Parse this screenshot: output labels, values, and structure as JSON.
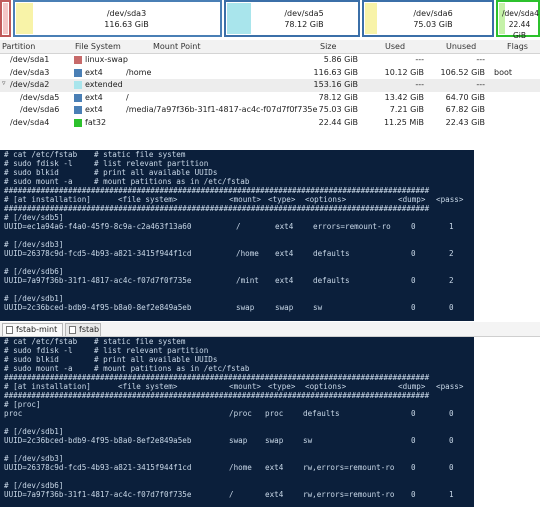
{
  "partition_bar": [
    {
      "name": "",
      "size": ""
    },
    {
      "name": "/dev/sda3",
      "size": "116.63 GiB"
    },
    {
      "name": "/dev/sda5",
      "size": "78.12 GiB"
    },
    {
      "name": "/dev/sda6",
      "size": "75.03 GiB"
    },
    {
      "name": "/dev/sda4",
      "size": "22.44 GiB"
    }
  ],
  "table": {
    "headers": {
      "partition": "Partition",
      "filesystem": "File System",
      "mount": "Mount Point",
      "size": "Size",
      "used": "Used",
      "unused": "Unused",
      "flags": "Flags"
    },
    "rows": [
      {
        "partition": "/dev/sda1",
        "fs": "linux-swap",
        "fs_color": "#c76a6a",
        "mount": "",
        "size": "5.86 GiB",
        "used": "---",
        "unused": "---",
        "flags": ""
      },
      {
        "partition": "/dev/sda3",
        "fs": "ext4",
        "fs_color": "#4a7fb5",
        "mount": "/home",
        "size": "116.63 GiB",
        "used": "10.12 GiB",
        "unused": "106.52 GiB",
        "flags": "boot"
      },
      {
        "partition": "/dev/sda2",
        "fs": "extended",
        "fs_color": "#a9e5ec",
        "mount": "",
        "size": "153.16 GiB",
        "used": "---",
        "unused": "---",
        "flags": ""
      },
      {
        "partition": "/dev/sda5",
        "fs": "ext4",
        "fs_color": "#4a7fb5",
        "mount": "/",
        "size": "78.12 GiB",
        "used": "13.42 GiB",
        "unused": "64.70 GiB",
        "flags": ""
      },
      {
        "partition": "/dev/sda6",
        "fs": "ext4",
        "fs_color": "#4a7fb5",
        "mount": "/media/7a97f36b-31f1-4817-ac4c-f07d7f0f735e",
        "size": "75.03 GiB",
        "used": "7.21 GiB",
        "unused": "67.82 GiB",
        "flags": ""
      },
      {
        "partition": "/dev/sda4",
        "fs": "fat32",
        "fs_color": "#2cc12c",
        "mount": "",
        "size": "22.44 GiB",
        "used": "11.25 MiB",
        "unused": "22.43 GiB",
        "flags": ""
      }
    ]
  },
  "terminal1": {
    "commands": [
      {
        "cmd": "# cat /etc/fstab",
        "comment": "# static file system"
      },
      {
        "cmd": "# sudo fdisk -l",
        "comment": "# list relevant partition"
      },
      {
        "cmd": "# sudo blkid",
        "comment": "# print all available UUIDs"
      },
      {
        "cmd": "# sudo mount -a",
        "comment": "# mount patitions as in /etc/fstab"
      }
    ],
    "hashline": "#############################################################################################",
    "header": {
      "c1": "# [at installation]",
      "c2": "<file system>",
      "c3": "<mount>",
      "c4": "<type>",
      "c5": "<options>",
      "c6": "<dump>",
      "c7": "<pass>"
    },
    "entries": [
      {
        "comment": "# [/dev/sdb5]",
        "uuid": "UUID=ec1a94a6-f4a0-45f9-8c9a-c2a463f13a60",
        "mount": "/",
        "type": "ext4",
        "options": "errors=remount-ro",
        "dump": "0",
        "pass": "1"
      },
      {
        "comment": "# [/dev/sdb3]",
        "uuid": "UUID=26378c9d-fcd5-4b93-a821-3415f944f1cd",
        "mount": "/home",
        "type": "ext4",
        "options": "defaults",
        "dump": "0",
        "pass": "2"
      },
      {
        "comment": "# [/dev/sdb6]",
        "uuid": "UUID=7a97f36b-31f1-4817-ac4c-f07d7f0f735e",
        "mount": "/mint",
        "type": "ext4",
        "options": "defaults",
        "dump": "0",
        "pass": "2"
      },
      {
        "comment": "# [/dev/sdb1]",
        "uuid": "UUID=2c36bced-bdb9-4f95-b8a0-8ef2e849a5eb",
        "mount": "swap",
        "type": "swap",
        "options": "sw",
        "dump": "0",
        "pass": "0"
      }
    ]
  },
  "tabs": [
    {
      "label": "fstab-mint"
    },
    {
      "label": "fstab"
    }
  ],
  "terminal2": {
    "commands": [
      {
        "cmd": "# cat /etc/fstab",
        "comment": "# static file system"
      },
      {
        "cmd": "# sudo fdisk -l",
        "comment": "# list relevant partition"
      },
      {
        "cmd": "# sudo blkid",
        "comment": "# print all available UUIDs"
      },
      {
        "cmd": "# sudo mount -a",
        "comment": "# mount patitions as in /etc/fstab"
      }
    ],
    "hashline": "#############################################################################################",
    "header": {
      "c1": "# [at installation]",
      "c2": "<file system>",
      "c3": "<mount>",
      "c4": "<type>",
      "c5": "<options>",
      "c6": "<dump>",
      "c7": "<pass>"
    },
    "entries": [
      {
        "comment": "# [proc]",
        "uuid": "proc",
        "mount": "/proc",
        "type": "proc",
        "options": "defaults",
        "dump": "0",
        "pass": "0"
      },
      {
        "comment": "# [/dev/sdb1]",
        "uuid": "UUID=2c36bced-bdb9-4f95-b8a0-8ef2e849a5eb",
        "mount": "swap",
        "type": "swap",
        "options": "sw",
        "dump": "0",
        "pass": "0"
      },
      {
        "comment": "# [/dev/sdb3]",
        "uuid": "UUID=26378c9d-fcd5-4b93-a821-3415f944f1cd",
        "mount": "/home",
        "type": "ext4",
        "options": "rw,errors=remount-ro",
        "dump": "0",
        "pass": "0"
      },
      {
        "comment": "# [/dev/sdb6]",
        "uuid": "UUID=7a97f36b-31f1-4817-ac4c-f07d7f0f735e",
        "mount": "/",
        "type": "ext4",
        "options": "rw,errors=remount-ro",
        "dump": "0",
        "pass": "1"
      }
    ]
  }
}
